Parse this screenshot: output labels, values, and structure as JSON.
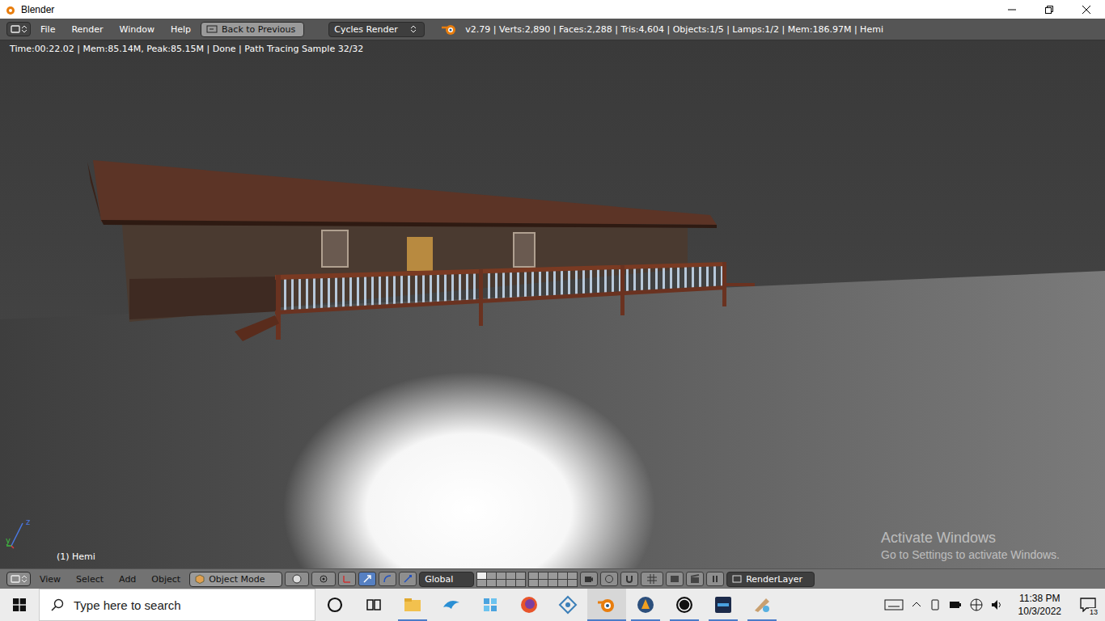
{
  "window": {
    "title": "Blender"
  },
  "info_header": {
    "menus": [
      "File",
      "Render",
      "Window",
      "Help"
    ],
    "back_button": "Back to Previous",
    "render_engine": "Cycles Render",
    "stats": "v2.79 | Verts:2,890 | Faces:2,288 | Tris:4,604 | Objects:1/5 | Lamps:1/2 | Mem:186.97M | Hemi"
  },
  "viewport": {
    "render_status": "Time:00:22.02 | Mem:85.14M, Peak:85.15M | Done | Path Tracing Sample 32/32",
    "object_label": "(1) Hemi",
    "axes": [
      {
        "label": "z",
        "color": "#4a78e0"
      },
      {
        "label": "y",
        "color": "#3fbf3f"
      }
    ],
    "watermark": {
      "title": "Activate Windows",
      "subtitle": "Go to Settings to activate Windows."
    }
  },
  "view_header": {
    "menus": [
      "View",
      "Select",
      "Add",
      "Object"
    ],
    "mode": "Object Mode",
    "orientation": "Global",
    "render_layer": "RenderLayer"
  },
  "taskbar": {
    "search_placeholder": "Type here to search",
    "apps": [
      {
        "kind": "cortana",
        "running": false,
        "active": false
      },
      {
        "kind": "task-view",
        "running": false,
        "active": false
      },
      {
        "kind": "explorer",
        "running": true,
        "active": false
      },
      {
        "kind": "dolphin",
        "running": false,
        "active": false
      },
      {
        "kind": "puzzle",
        "running": false,
        "active": false
      },
      {
        "kind": "firefox",
        "running": false,
        "active": false
      },
      {
        "kind": "diamond",
        "running": false,
        "active": false
      },
      {
        "kind": "blender",
        "running": true,
        "active": true
      },
      {
        "kind": "viewer",
        "running": true,
        "active": false
      },
      {
        "kind": "unreal",
        "running": true,
        "active": false
      },
      {
        "kind": "launcher",
        "running": true,
        "active": false
      },
      {
        "kind": "paint",
        "running": true,
        "active": false
      }
    ],
    "time": "11:38 PM",
    "date": "10/3/2022",
    "notifications": "13"
  }
}
